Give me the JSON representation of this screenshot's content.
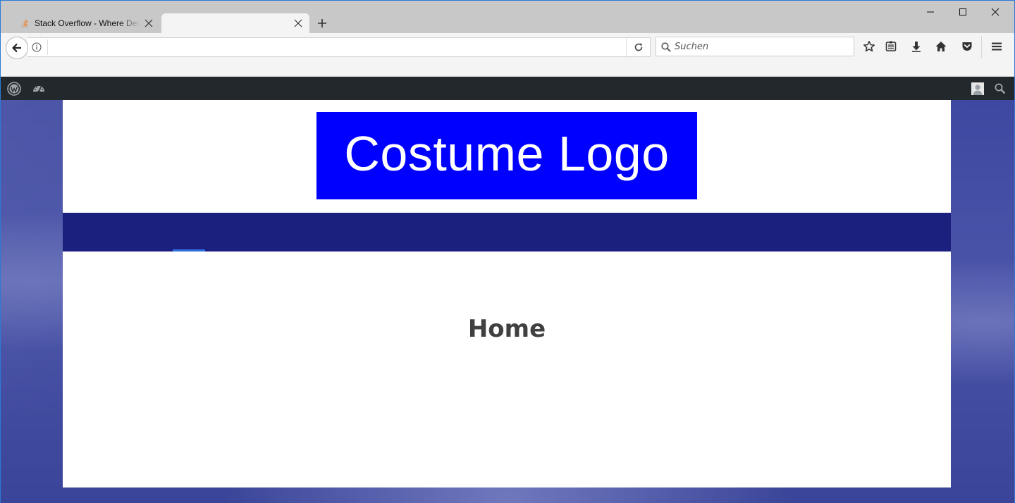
{
  "browser": {
    "tabs": [
      {
        "title": "Stack Overflow - Where Developers Learn, Share, & Build Careers",
        "active": false,
        "favicon": "stackoverflow-icon"
      },
      {
        "title": "",
        "active": true
      }
    ],
    "url": "",
    "search": {
      "placeholder": "Suchen",
      "value": ""
    },
    "toolbar_icons": [
      "star-icon",
      "reading-list-icon",
      "download-icon",
      "home-icon",
      "pocket-icon",
      "menu-icon"
    ],
    "window_controls": [
      "minimize-icon",
      "maximize-icon",
      "close-icon"
    ]
  },
  "admin_bar": {
    "left_icons": [
      "wordpress-icon",
      "dashboard-icon"
    ],
    "right_icons": [
      "avatar",
      "search-icon"
    ]
  },
  "site": {
    "logo_text": "Costume Logo",
    "logo_color": "#0000ff",
    "nav_color": "#1b1f7e",
    "nav_active_color": "#2f6fe0",
    "page_title": "Home"
  }
}
